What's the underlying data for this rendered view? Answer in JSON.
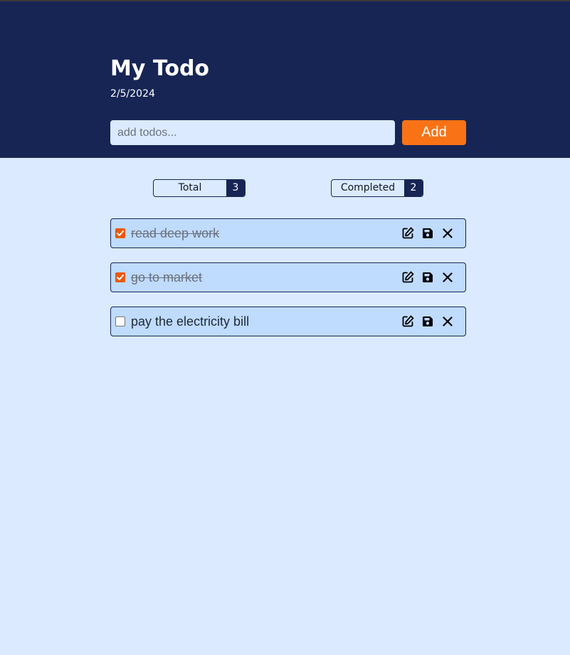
{
  "header": {
    "title": "My Todo",
    "date": "2/5/2024"
  },
  "add_form": {
    "placeholder": "add todos...",
    "value": "",
    "button_label": "Add"
  },
  "stats": {
    "total_label": "Total",
    "total_count": "3",
    "completed_label": "Completed",
    "completed_count": "2"
  },
  "todos": [
    {
      "text": "read deep work",
      "completed": true
    },
    {
      "text": "go to market",
      "completed": true
    },
    {
      "text": "pay the electricity bill",
      "completed": false
    }
  ],
  "icons": {
    "edit": "edit-icon",
    "save": "save-icon",
    "delete": "close-icon"
  },
  "colors": {
    "header_bg": "#172554",
    "page_bg": "#dbeafe",
    "accent": "#f97316",
    "todo_bg": "#bfdbfe"
  }
}
